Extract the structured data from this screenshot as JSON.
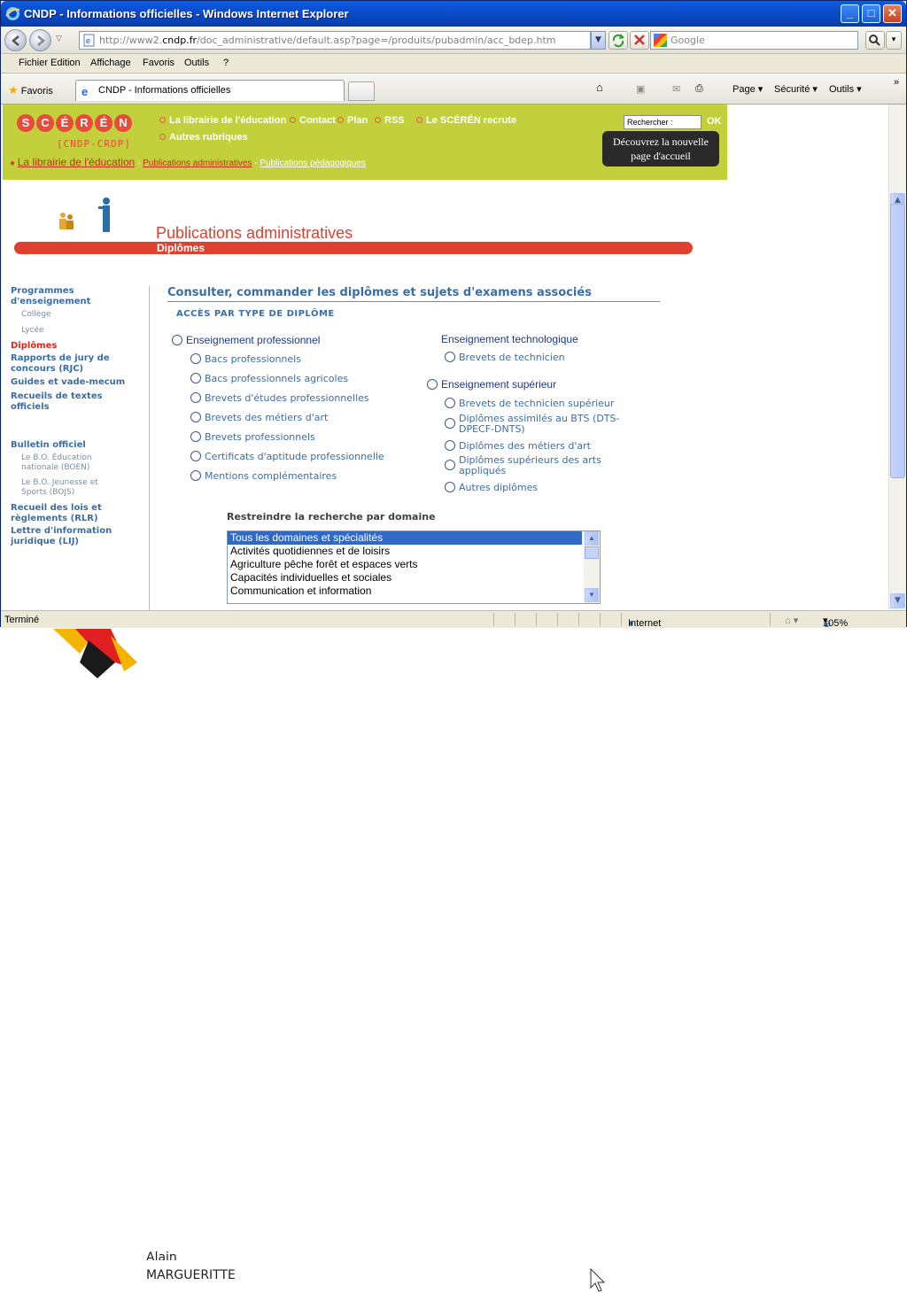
{
  "window": {
    "title": "CNDP - Informations officielles - Windows Internet Explorer"
  },
  "address": {
    "prefix": "http://www2.",
    "domain": "cndp.fr",
    "path": "/doc_administrative/default.asp?page=/produits/pubadmin/acc_bdep.htm"
  },
  "search_engine": "Google",
  "menu": [
    "Fichier",
    "Edition",
    "Affichage",
    "Favoris",
    "Outils",
    "?"
  ],
  "favorites": {
    "label": "Favoris",
    "tab": "CNDP - Informations officielles"
  },
  "commands": {
    "page": "Page",
    "security": "Sécurité",
    "tools": "Outils"
  },
  "header": {
    "logo_sub": "[CNDP-CRDP]",
    "nav": [
      "La librairie de l'éducation",
      "Contact",
      "Plan",
      "RSS",
      "Le SCÉRÉN recrute",
      "Autres rubriques"
    ],
    "search_label": "Rechercher :",
    "ok": "OK",
    "banner": [
      "Découvrez la nouvelle",
      "page d'accueil"
    ],
    "crumb": {
      "main": "La librairie de l'éducation",
      "sep": " - ",
      "admin": "Publications administratives",
      "peda": "Publications pédagogiques"
    }
  },
  "section": {
    "title": "Publications administratives",
    "subtitle": "Diplômes"
  },
  "sidebar": {
    "programmes": [
      "Programmes",
      "d'enseignement"
    ],
    "college": "Collège",
    "lycee": "Lycée",
    "diplomes": "Diplômes",
    "rapports": [
      "Rapports de jury de",
      "concours (RJC)"
    ],
    "guides": "Guides et vade-mecum",
    "recueils": [
      "Recueils de textes",
      "officiels"
    ],
    "bulletin": "Bulletin officiel",
    "bo1": [
      "Le B.O. Éducation",
      "nationale (BOEN)"
    ],
    "bo2": [
      "Le B.O. Jeunesse et",
      "Sports (BOJS)"
    ],
    "rlr": [
      "Recueil des lois et",
      "règlements (RLR)"
    ],
    "lij": [
      "Lettre d'information",
      "juridique (LIJ)"
    ]
  },
  "main": {
    "title": "Consulter, commander les diplômes et sujets d'examens associés",
    "acces": "ACCÈS PAR TYPE DE DIPLÔME",
    "pro": "Enseignement professionnel",
    "pro_items": [
      "Bacs professionnels",
      "Bacs professionnels agricoles",
      "Brevets d'études professionnelles",
      "Brevets des métiers d'art",
      "Brevets professionnels",
      "Certificats d'aptitude professionnelle",
      "Mentions complémentaires"
    ],
    "techno": "Enseignement technologique",
    "techno_items": [
      "Brevets de technicien"
    ],
    "sup": "Enseignement supérieur",
    "sup_items": [
      "Brevets de technicien supérieur",
      "Diplômes assimilés au BTS (DTS-",
      "DPECF-DNTS)",
      "Diplômes des métiers d'art",
      "Diplômes supérieurs des arts",
      "appliqués",
      "Autres diplômes"
    ],
    "restrict": "Restreindre la recherche par domaine",
    "domains": [
      "Tous les domaines et spécialités",
      "Activités quotidiennes et de loisirs",
      "Agriculture pêche forêt et espaces verts",
      "Capacités individuelles et sociales",
      "Communication et information"
    ]
  },
  "status": {
    "text": "Terminé",
    "zone": "Internet",
    "zoom": "105%"
  },
  "behind": {
    "name1": "Alain",
    "name2": "MARGUERITTE"
  }
}
